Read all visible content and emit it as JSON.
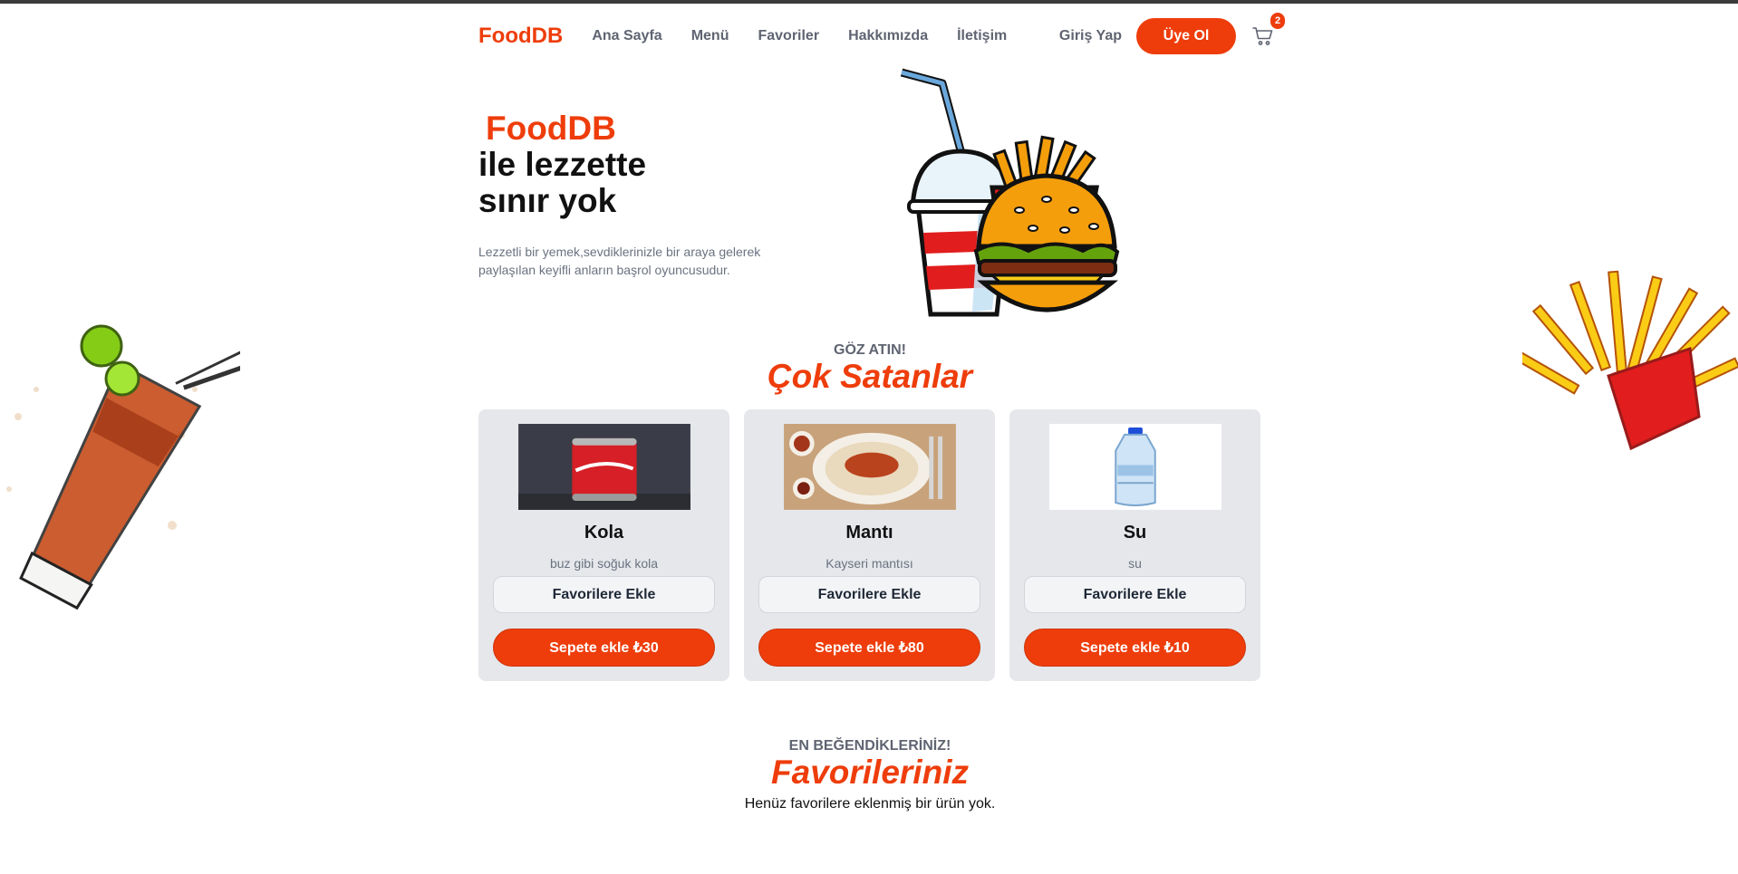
{
  "nav": {
    "brand": "FoodDB",
    "links": [
      "Ana Sayfa",
      "Menü",
      "Favoriler",
      "Hakkımızda",
      "İletişim"
    ],
    "login": "Giriş Yap",
    "signup": "Üye Ol",
    "cart_count": "2"
  },
  "hero": {
    "brand": "FoodDB",
    "line1": "ile lezzette",
    "line2": "sınır yok",
    "description": "Lezzetli bir yemek,sevdiklerinizle bir araya gelerek paylaşılan keyifli anların başrol oyuncusudur."
  },
  "bestsellers": {
    "eyebrow": "GÖZ ATIN!",
    "title": "Çok Satanlar",
    "products": [
      {
        "name": "Kola",
        "description": "buz gibi soğuk kola",
        "fav_label": "Favorilere Ekle",
        "cart_label": "Sepete ekle ₺30"
      },
      {
        "name": "Mantı",
        "description": "Kayseri mantısı",
        "fav_label": "Favorilere Ekle",
        "cart_label": "Sepete ekle ₺80"
      },
      {
        "name": "Su",
        "description": "su",
        "fav_label": "Favorilere Ekle",
        "cart_label": "Sepete ekle ₺10"
      }
    ]
  },
  "favorites": {
    "eyebrow": "EN BEĞENDİKLERİNİZ!",
    "title": "Favorileriniz",
    "empty_message": "Henüz favorilere eklenmiş bir ürün yok."
  },
  "colors": {
    "accent": "#ee3d0b",
    "muted_text": "#5f6471",
    "card_bg": "#e5e7eb"
  }
}
